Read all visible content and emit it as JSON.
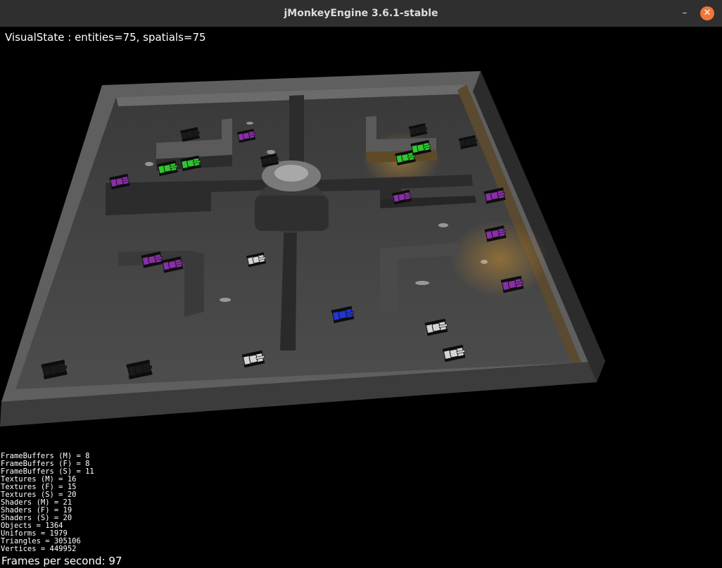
{
  "window": {
    "title": "jMonkeyEngine 3.6.1-stable",
    "minimize_symbol": "–",
    "close_symbol": "✕"
  },
  "hud": {
    "visual_state": "VisualState : entities=75, spatials=75",
    "stats": [
      "FrameBuffers (M) = 8",
      "FrameBuffers (F) = 8",
      "FrameBuffers (S) = 11",
      "Textures (M) = 16",
      "Textures (F) = 15",
      "Textures (S) = 20",
      "Shaders (M) = 21",
      "Shaders (F) = 19",
      "Shaders (S) = 20",
      "Objects = 1364",
      "Uniforms = 1979",
      "Triangles = 305106",
      "Vertices = 449952"
    ],
    "fps": "Frames per second: 97"
  },
  "colors": {
    "titlebar": "#2f2f2f",
    "close_button": "#f0763a",
    "floor": "#4a4a4a",
    "tank_green": "#2ec82e",
    "tank_purple": "#8a2fa8",
    "tank_blue": "#2236d8",
    "tank_black": "#1a1a1a",
    "tank_white": "#d4d4d4"
  },
  "tanks": [
    {
      "team": "black"
    },
    {
      "team": "purple"
    },
    {
      "team": "black"
    },
    {
      "team": "black"
    },
    {
      "team": "black"
    },
    {
      "team": "green"
    },
    {
      "team": "green"
    },
    {
      "team": "purple"
    },
    {
      "team": "green"
    },
    {
      "team": "green"
    },
    {
      "team": "purple"
    },
    {
      "team": "purple"
    },
    {
      "team": "purple"
    },
    {
      "team": "purple"
    },
    {
      "team": "purple"
    },
    {
      "team": "white"
    },
    {
      "team": "purple"
    },
    {
      "team": "blue"
    },
    {
      "team": "white"
    },
    {
      "team": "white"
    },
    {
      "team": "white"
    },
    {
      "team": "black"
    },
    {
      "team": "black"
    }
  ]
}
